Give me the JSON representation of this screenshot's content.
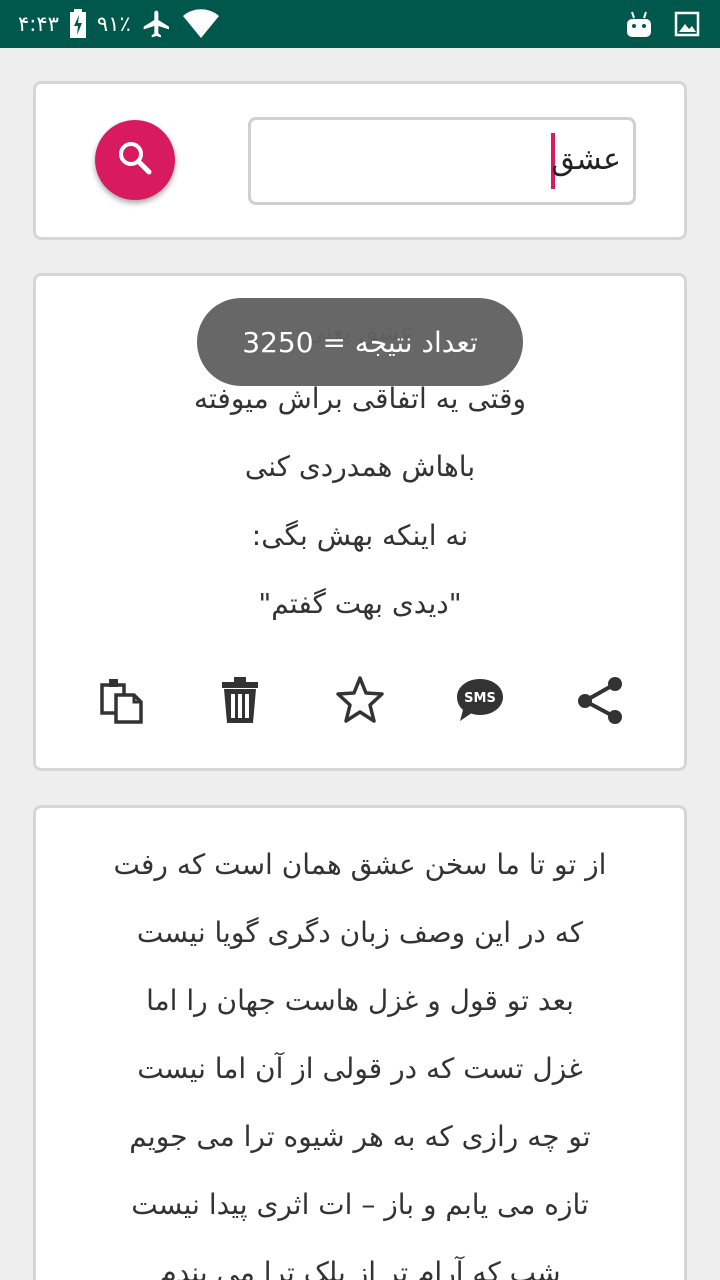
{
  "status_bar": {
    "time": "۴:۴۳",
    "battery": "۹۱٪",
    "icons": [
      "battery-charging-icon",
      "airplane-mode-icon",
      "wifi-icon",
      "android-icon",
      "image-icon"
    ]
  },
  "search": {
    "query": "عشق",
    "button_icon": "search-icon"
  },
  "toast": {
    "text": "تعداد نتیجه = 3250"
  },
  "post": {
    "title": "عشق یعنی",
    "lines": [
      "وقتی یه اتفاقی براش میوفته",
      "باهاش همدردی کنی",
      "نه اینکه بهش بگی:",
      "\"دیدی بهت گفتم\""
    ],
    "actions": [
      "copy-icon",
      "delete-icon",
      "favorite-icon",
      "sms-icon",
      "share-icon"
    ]
  },
  "poem": {
    "lines": [
      "از تو تا ما سخن عشق همان است که رفت",
      "که در این وصف زبان دگری گویا نیست",
      "بعد تو قول و غزل هاست جهان را اما",
      "غزل تست که در قولی از آن اما نیست",
      "تو چه رازی که به هر شیوه ترا می جویم",
      "تازه می یابم و باز – ات اثری پیدا نیست",
      "شب که آرام تر از پلک ترا می بندم"
    ]
  }
}
